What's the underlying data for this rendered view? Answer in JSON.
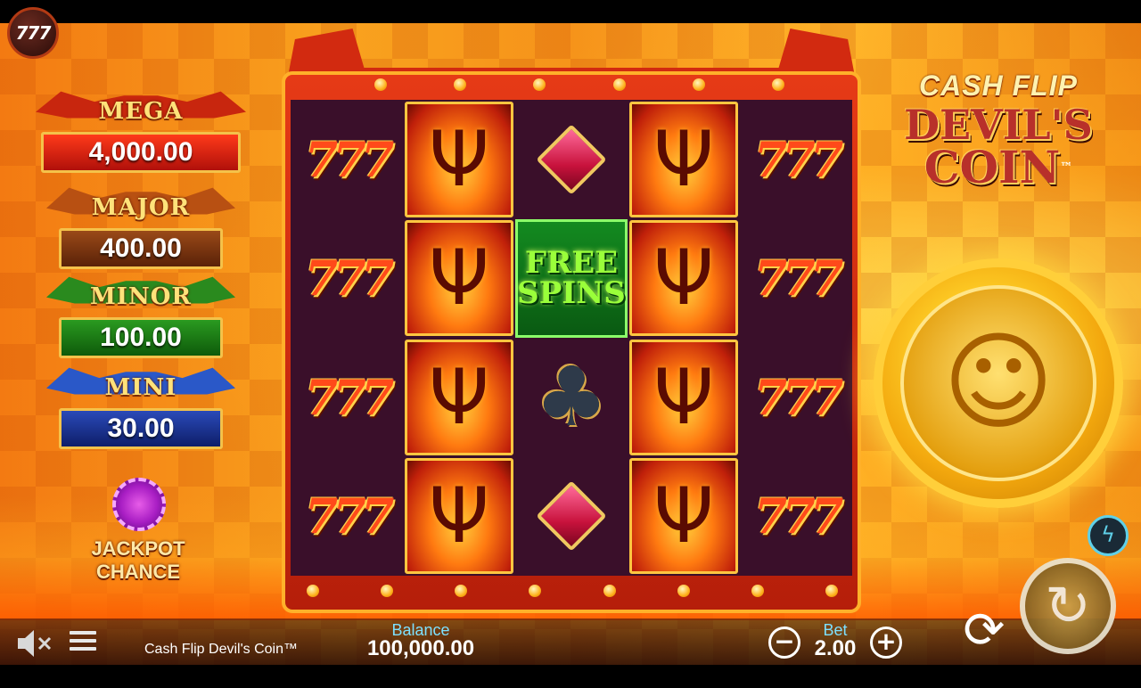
{
  "badge": {
    "label": "777"
  },
  "jackpots": [
    {
      "title": "MEGA",
      "value": "4,000.00",
      "color": "#d02010"
    },
    {
      "title": "MAJOR",
      "value": "400.00",
      "color": "#7a3a10"
    },
    {
      "title": "MINOR",
      "value": "100.00",
      "color": "#1f7a1a"
    },
    {
      "title": "MINI",
      "value": "30.00",
      "color": "#1a3a9a"
    }
  ],
  "jackpot_chance": {
    "label": "JACKPOT CHANCE"
  },
  "logo": {
    "line1": "CASH FLIP",
    "line2": "DEVIL'S",
    "line3": "COIN",
    "tm": "™"
  },
  "reels": [
    [
      "777",
      "777",
      "777",
      "777"
    ],
    [
      "trident",
      "trident",
      "trident",
      "trident"
    ],
    [
      "diamond",
      "free_spins",
      "club",
      "diamond"
    ],
    [
      "trident",
      "trident",
      "trident",
      "trident"
    ],
    [
      "777",
      "777",
      "777",
      "777"
    ]
  ],
  "free_spins": {
    "line1": "FREE",
    "line2": "SPINS"
  },
  "bottom_bar": {
    "game_name": "Cash Flip Devil's Coin™",
    "balance_label": "Balance",
    "balance_value": "100,000.00",
    "bet_label": "Bet",
    "bet_value": "2.00",
    "minus": "−",
    "plus": "+"
  },
  "icons": {
    "sound": "speaker-muted-icon",
    "menu": "hamburger-menu-icon",
    "autoplay": "autoplay-icon",
    "spin": "spin-icon",
    "turbo": "lightning-icon"
  }
}
